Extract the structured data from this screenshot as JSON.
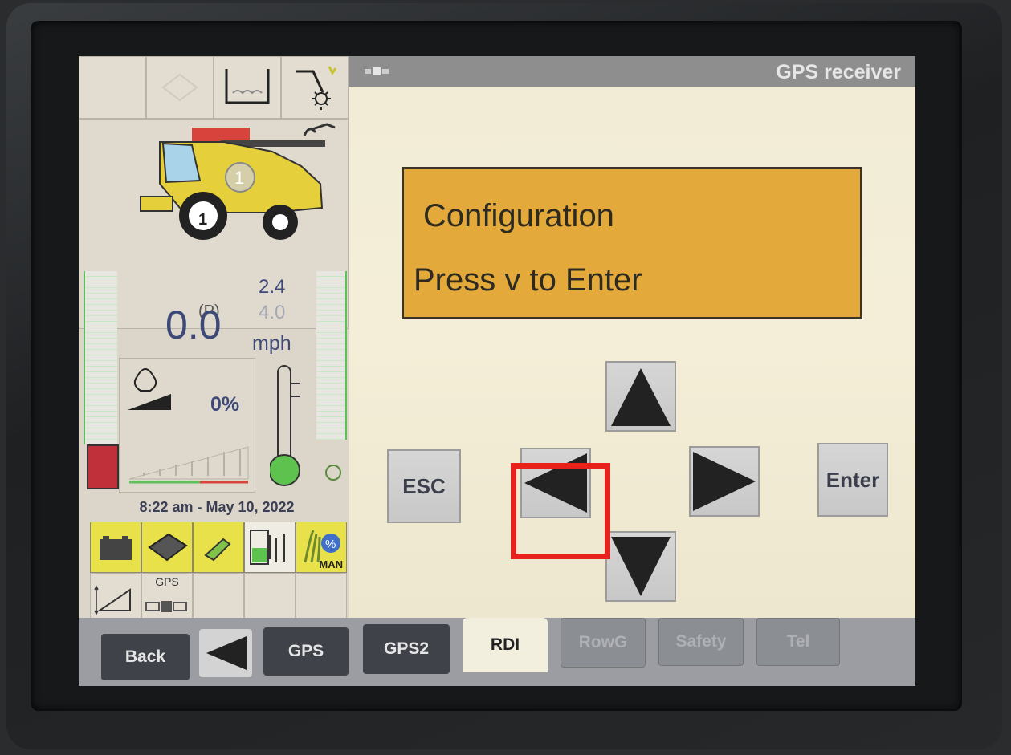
{
  "window": {
    "title": "GPS receiver"
  },
  "left_panel": {
    "park_indicator": "(P)",
    "machine_number": "1",
    "ground_speed": "0.0",
    "speed_setpoint_1": "2.4",
    "speed_setpoint_2": "4.0",
    "speed_unit": "mph",
    "engine_load": "0%",
    "datetime": "8:22 am - May 10, 2022",
    "status_icons": [
      "battery-icon",
      "controller-icon",
      "fuel-nozzle-icon",
      "fuel-pump-icon",
      "crop-percent-icon"
    ],
    "crop_mode": "MAN",
    "gps_label": "GPS"
  },
  "message": {
    "line1": "Configuration",
    "line2": "Press v to Enter"
  },
  "keys": {
    "esc": "ESC",
    "enter": "Enter"
  },
  "tabs": {
    "back": "Back",
    "gps": "GPS",
    "gps2": "GPS2",
    "rdi": "RDI",
    "rowg": "RowG",
    "safety": "Safety",
    "tel": "Tel"
  },
  "colors": {
    "message_bg": "#e3a93a",
    "highlight": "#e8211c",
    "title_bar": "#8e8e8e",
    "status_yellow": "#e8e14a"
  }
}
